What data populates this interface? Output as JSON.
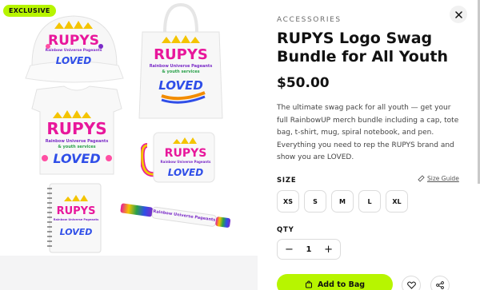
{
  "media": {
    "badge": "EXCLUSIVE",
    "logo": {
      "brand": "RUPYS",
      "tagline_1": "Rainbow Universe Pageants",
      "tagline_2": "& youth services",
      "loved": "LOVED"
    }
  },
  "product": {
    "category": "ACCESSORIES",
    "title": "RUPYS Logo Swag Bundle for All Youth",
    "price": "$50.00",
    "description": "The ultimate swag pack for all youth — get your full RainbowUP merch bundle including a cap, tote bag, t-shirt, mug, spiral notebook, and pen. Everything you need to rep the RUPYS brand and show you are LOVED."
  },
  "size": {
    "label": "SIZE",
    "guide_label": "Size Guide",
    "options": [
      "XS",
      "S",
      "M",
      "L",
      "XL"
    ]
  },
  "quantity": {
    "label": "QTY",
    "value": "1",
    "minus": "−",
    "plus": "+"
  },
  "actions": {
    "add_to_bag": "Add to Bag"
  },
  "colors": {
    "accent": "#b7f500",
    "text": "#111111"
  },
  "icons": [
    "close-icon",
    "ruler-icon",
    "bag-icon",
    "heart-icon",
    "share-icon"
  ]
}
